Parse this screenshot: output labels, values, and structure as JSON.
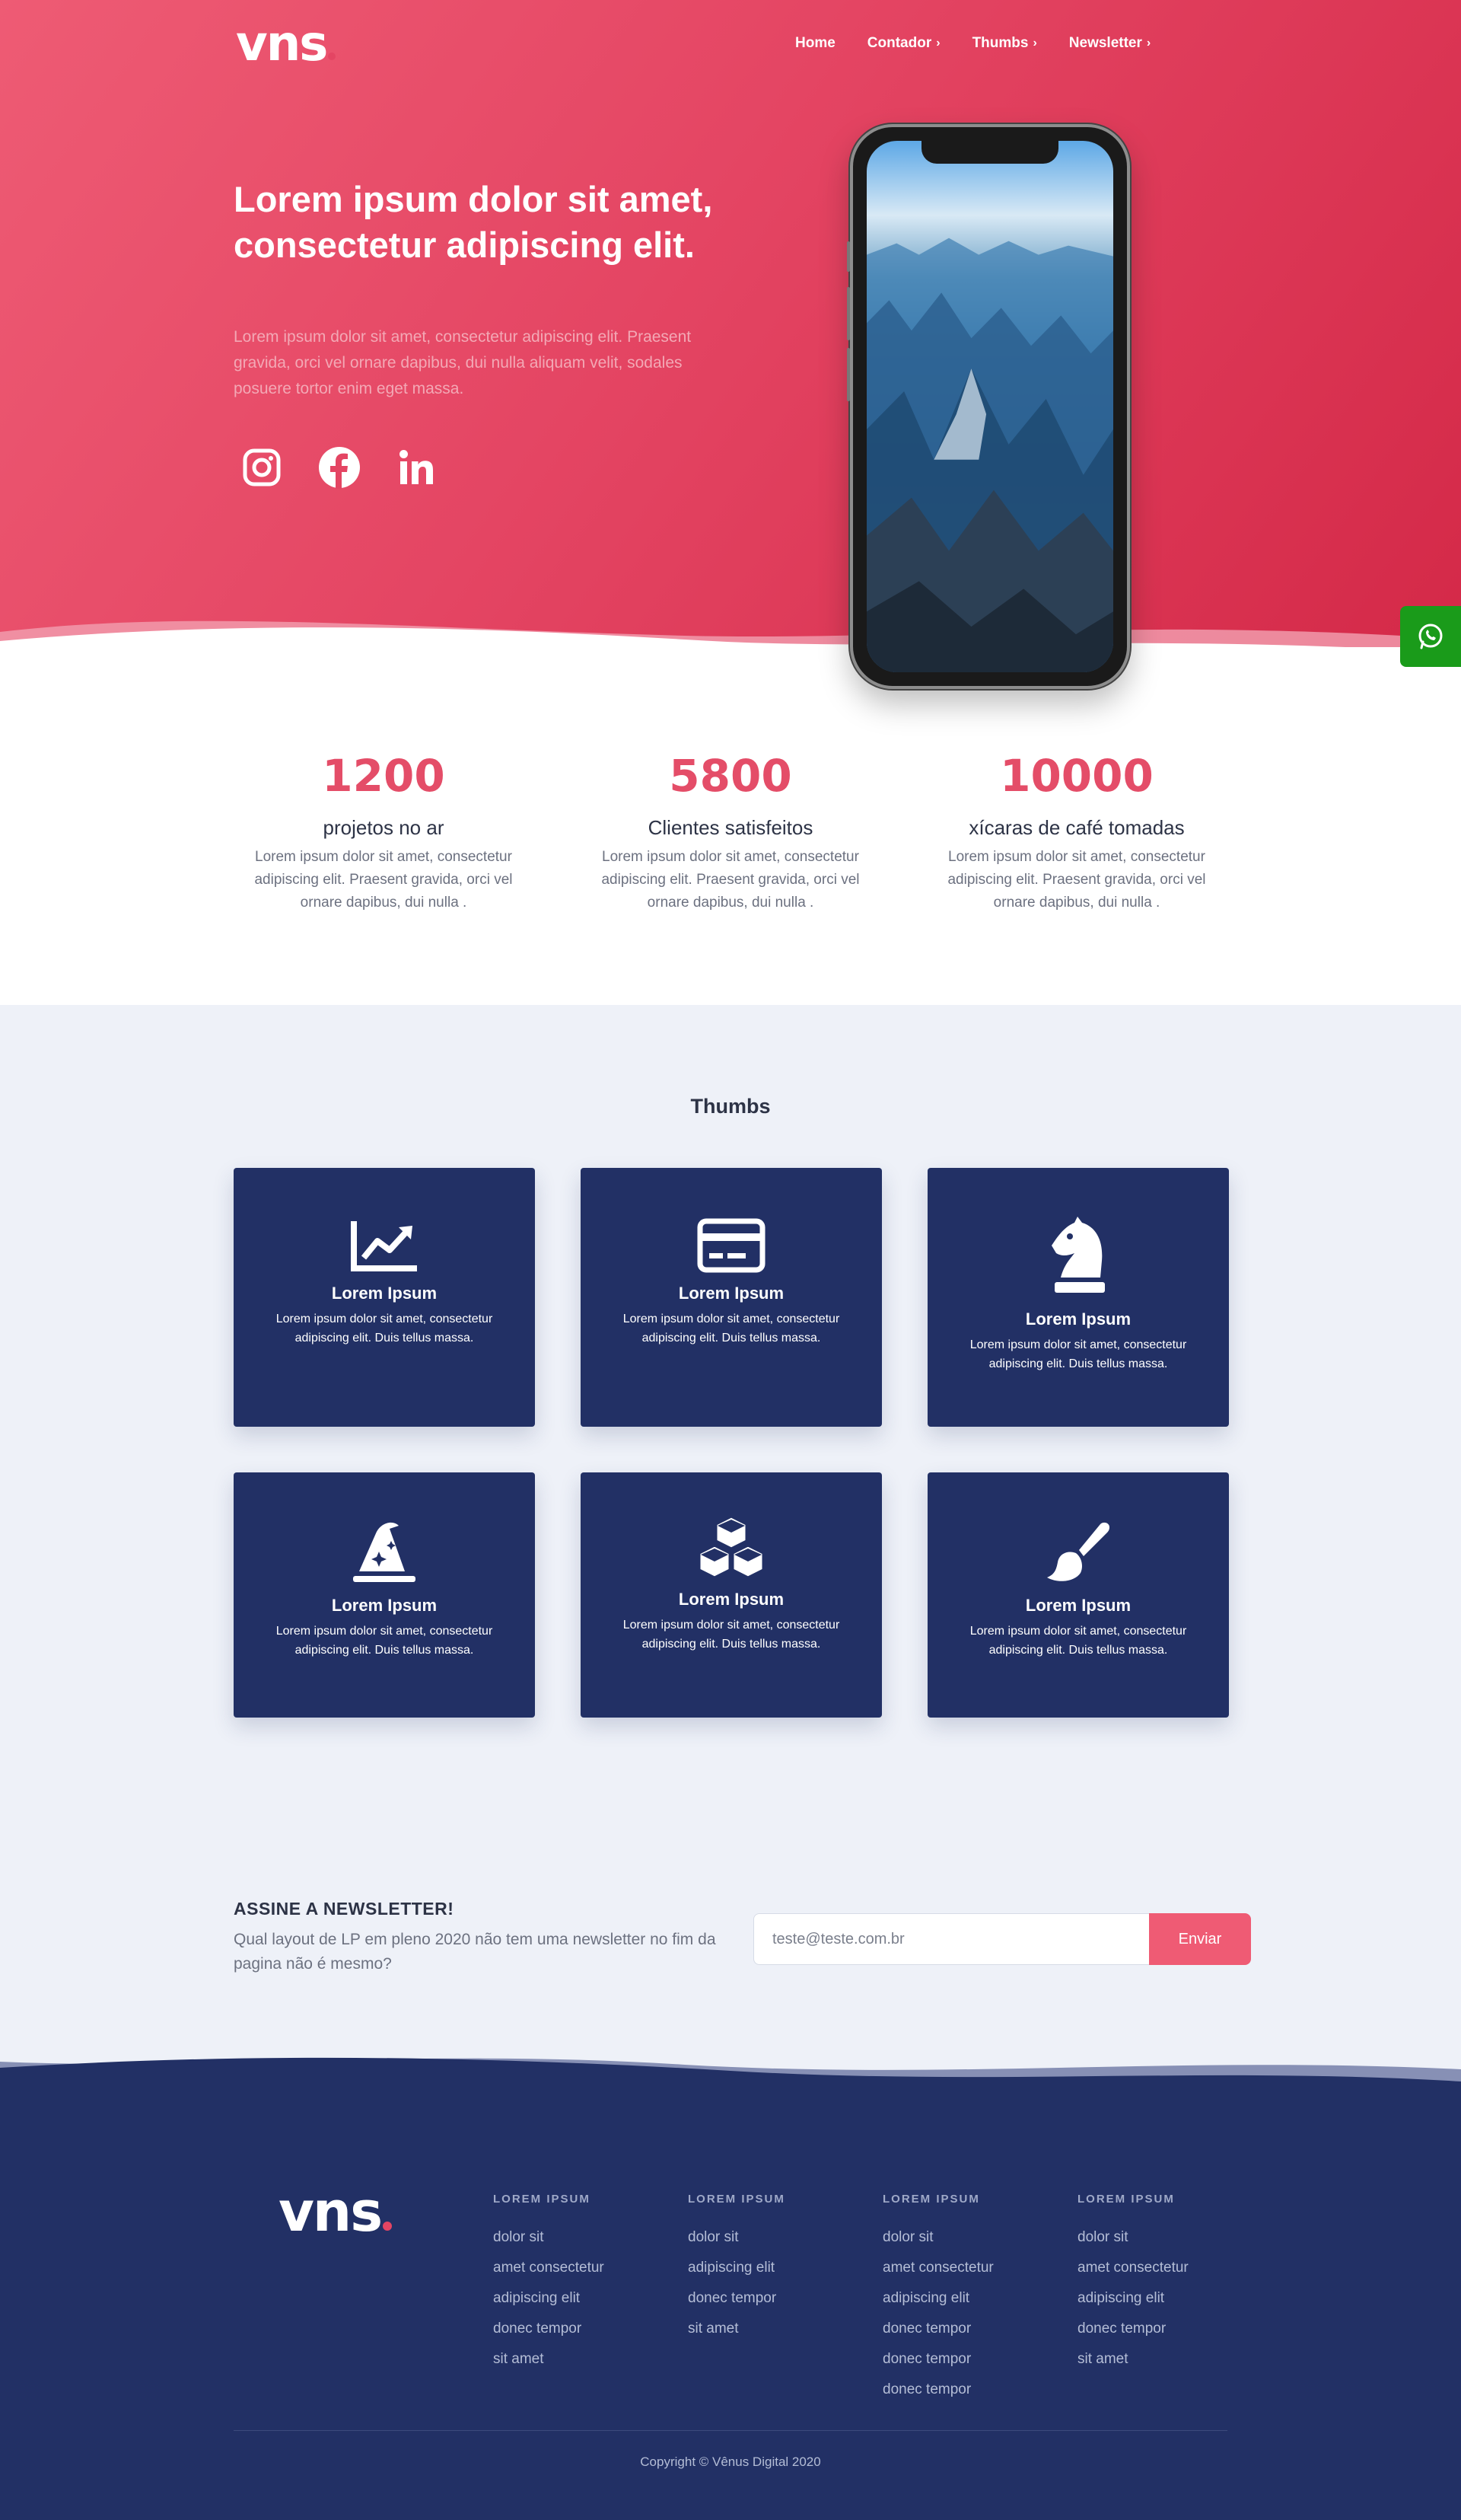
{
  "brand": {
    "logo_text": "vns",
    "accent": "#e44563",
    "navy": "#223065",
    "whatsapp_green": "#1a9b1a"
  },
  "nav": {
    "items": [
      {
        "label": "Home",
        "has_chevron": false
      },
      {
        "label": "Contador",
        "has_chevron": true
      },
      {
        "label": "Thumbs",
        "has_chevron": true
      },
      {
        "label": "Newsletter",
        "has_chevron": true
      }
    ],
    "chevron": "›"
  },
  "hero": {
    "title": "Lorem ipsum dolor sit amet, consectetur adipiscing elit.",
    "text": "Lorem ipsum dolor sit amet, consectetur adipiscing elit. Praesent gravida, orci vel ornare dapibus, dui nulla aliquam velit, sodales posuere tortor enim eget massa.",
    "social": [
      "instagram-icon",
      "facebook-icon",
      "linkedin-icon"
    ]
  },
  "counters": [
    {
      "number": "1200",
      "label": "projetos no ar",
      "text": "Lorem ipsum dolor sit amet, consectetur adipiscing elit. Praesent gravida, orci vel ornare dapibus, dui nulla ."
    },
    {
      "number": "5800",
      "label": "Clientes satisfeitos",
      "text": "Lorem ipsum dolor sit amet, consectetur adipiscing elit. Praesent gravida, orci vel ornare dapibus, dui nulla ."
    },
    {
      "number": "10000",
      "label": "xícaras de café tomadas",
      "text": "Lorem ipsum dolor sit amet, consectetur adipiscing elit. Praesent gravida, orci vel ornare dapibus, dui nulla ."
    }
  ],
  "thumbs": {
    "title": "Thumbs",
    "cards": [
      {
        "icon": "chart-line-icon",
        "title": "Lorem Ipsum",
        "text": "Lorem ipsum dolor sit amet, consectetur adipiscing elit. Duis tellus massa."
      },
      {
        "icon": "credit-card-icon",
        "title": "Lorem Ipsum",
        "text": "Lorem ipsum dolor sit amet, consectetur adipiscing elit. Duis tellus massa."
      },
      {
        "icon": "chess-knight-icon",
        "title": "Lorem Ipsum",
        "text": "Lorem ipsum dolor sit amet, consectetur adipiscing elit. Duis tellus massa."
      },
      {
        "icon": "wizard-hat-icon",
        "title": "Lorem Ipsum",
        "text": "Lorem ipsum dolor sit amet, consectetur adipiscing elit. Duis tellus massa."
      },
      {
        "icon": "cubes-icon",
        "title": "Lorem Ipsum",
        "text": "Lorem ipsum dolor sit amet, consectetur adipiscing elit. Duis tellus massa."
      },
      {
        "icon": "paint-brush-icon",
        "title": "Lorem Ipsum",
        "text": "Lorem ipsum dolor sit amet, consectetur adipiscing elit. Duis tellus massa."
      }
    ]
  },
  "newsletter": {
    "title": "ASSINE A NEWSLETTER!",
    "text": "Qual layout de LP em pleno 2020 não tem uma newsletter no fim da pagina não é mesmo?",
    "placeholder": "teste@teste.com.br",
    "button": "Enviar"
  },
  "footer": {
    "logo_text": "vns",
    "columns": [
      {
        "heading": "LOREM IPSUM",
        "links": [
          "dolor sit",
          "amet consectetur",
          "adipiscing elit",
          "donec tempor",
          "sit amet"
        ]
      },
      {
        "heading": "LOREM IPSUM",
        "links": [
          "dolor sit",
          "adipiscing elit",
          "donec tempor",
          "sit amet"
        ]
      },
      {
        "heading": "LOREM IPSUM",
        "links": [
          "dolor sit",
          "amet consectetur",
          "adipiscing elit",
          "donec tempor",
          "donec tempor",
          "donec tempor"
        ]
      },
      {
        "heading": "LOREM IPSUM",
        "links": [
          "dolor sit",
          "amet consectetur",
          "adipiscing elit",
          "donec tempor",
          "sit amet"
        ]
      }
    ],
    "copyright": "Copyright © Vênus Digital 2020"
  }
}
